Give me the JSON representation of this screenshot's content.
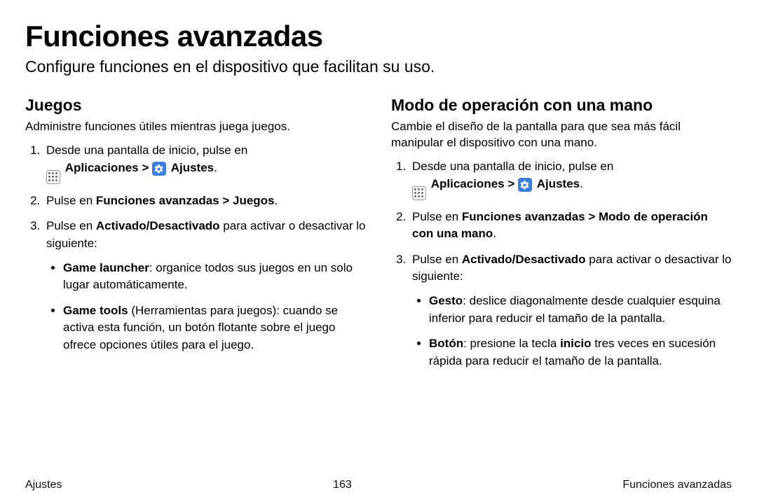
{
  "header": {
    "title": "Funciones avanzadas",
    "subtitle": "Configure funciones en el dispositivo que facilitan su uso."
  },
  "left": {
    "heading": "Juegos",
    "intro": "Administre funciones útiles mientras juega juegos.",
    "step1_a": "Desde una pantalla de inicio, pulse en ",
    "apps_label": "Aplicaciones",
    "settings_label": "Ajustes",
    "step2_a": "Pulse en ",
    "step2_b": "Funciones avanzadas > Juegos",
    "step2_c": ".",
    "step3_a": "Pulse en ",
    "step3_b": "Activado/Desactivado",
    "step3_c": " para activar o desactivar lo siguiente:",
    "bullet1_a": "Game launcher",
    "bullet1_b": ": organice todos sus juegos en un solo lugar automáticamente.",
    "bullet2_a": "Game tools",
    "bullet2_b": " (Herramientas para juegos): cuando se activa esta función, un botón flotante sobre el juego ofrece opciones útiles para el juego."
  },
  "right": {
    "heading": "Modo de operación con una mano",
    "intro": "Cambie el diseño de la pantalla para que sea más fácil manipular el dispositivo con una mano.",
    "step1_a": "Desde una pantalla de inicio, pulse en ",
    "apps_label": "Aplicaciones",
    "settings_label": "Ajustes",
    "step2_a": "Pulse en ",
    "step2_b": "Funciones avanzadas > Modo de operación con una mano",
    "step2_c": ".",
    "step3_a": "Pulse en ",
    "step3_b": "Activado/Desactivado",
    "step3_c": " para activar o desactivar lo siguiente:",
    "bullet1_a": "Gesto",
    "bullet1_b": ": deslice diagonalmente desde cualquier esquina inferior para reducir el tamaño de la pantalla.",
    "bullet2_a": "Botón",
    "bullet2_b": ": presione la tecla ",
    "bullet2_c": "inicio",
    "bullet2_d": " tres veces en sucesión rápida para reducir el tamaño de la pantalla."
  },
  "footer": {
    "left": "Ajustes",
    "center": "163",
    "right": "Funciones avanzadas"
  },
  "glyphs": {
    "arrow": " > ",
    "period": "."
  }
}
